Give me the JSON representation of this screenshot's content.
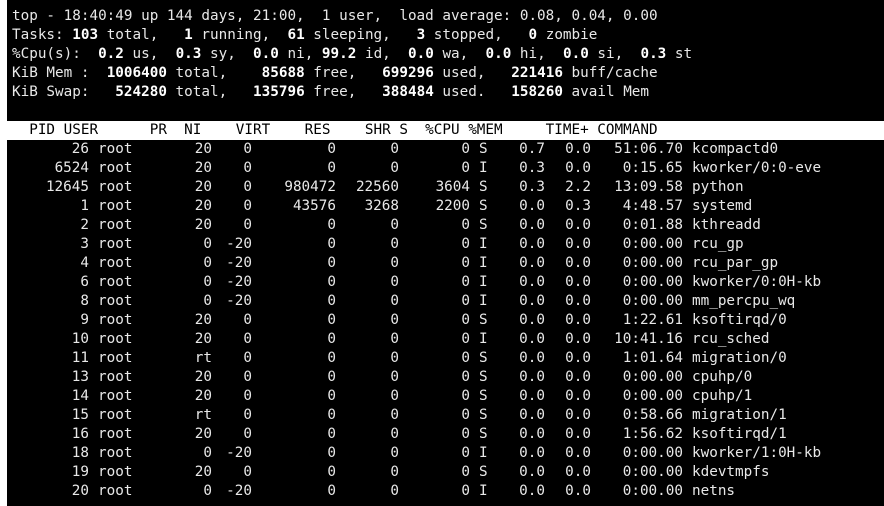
{
  "summary": {
    "l1": "top - 18:40:49 up 144 days, 21:00,  1 user,  load average: 0.08, 0.04, 0.00",
    "tasks": {
      "label": "Tasks:",
      "total": "103",
      "t_total": " total,   ",
      "running": "1",
      "t_running": " running,  ",
      "sleeping": "61",
      "t_sleeping": " sleeping,   ",
      "stopped": "3",
      "t_stopped": " stopped,   ",
      "zombie": "0",
      "t_zombie": " zombie"
    },
    "cpu": {
      "label": "%Cpu(s):  ",
      "us": "0.2",
      "t_us": " us,  ",
      "sy": "0.3",
      "t_sy": " sy,  ",
      "ni": "0.0",
      "t_ni": " ni, ",
      "id": "99.2",
      "t_id": " id,  ",
      "wa": "0.0",
      "t_wa": " wa,  ",
      "hi": "0.0",
      "t_hi": " hi,  ",
      "si": "0.0",
      "t_si": " si,  ",
      "st": "0.3",
      "t_st": " st"
    },
    "mem": {
      "label": "KiB Mem :  ",
      "total": "1006400",
      "t_total": " total,    ",
      "free": "85688",
      "t_free": " free,   ",
      "used": "699296",
      "t_used": " used,   ",
      "buff": "221416",
      "t_buff": " buff/cache"
    },
    "swap": {
      "label": "KiB Swap:   ",
      "total": "524280",
      "t_total": " total,   ",
      "free": "135796",
      "t_free": " free,   ",
      "used": "388484",
      "t_used": " used.   ",
      "avail": "158260",
      "t_avail": " avail Mem"
    }
  },
  "columns_header": "  PID USER      PR  NI    VIRT    RES    SHR S  %CPU %MEM     TIME+ COMMAND",
  "processes": [
    [
      "26",
      "root",
      "20",
      "0",
      "0",
      "0",
      "0",
      "S",
      "0.7",
      "0.0",
      "51:06.70",
      "kcompactd0"
    ],
    [
      "6524",
      "root",
      "20",
      "0",
      "0",
      "0",
      "0",
      "I",
      "0.3",
      "0.0",
      "0:15.65",
      "kworker/0:0-eve"
    ],
    [
      "12645",
      "root",
      "20",
      "0",
      "980472",
      "22560",
      "3604",
      "S",
      "0.3",
      "2.2",
      "13:09.58",
      "python"
    ],
    [
      "1",
      "root",
      "20",
      "0",
      "43576",
      "3268",
      "2200",
      "S",
      "0.0",
      "0.3",
      "4:48.57",
      "systemd"
    ],
    [
      "2",
      "root",
      "20",
      "0",
      "0",
      "0",
      "0",
      "S",
      "0.0",
      "0.0",
      "0:01.88",
      "kthreadd"
    ],
    [
      "3",
      "root",
      "0",
      "-20",
      "0",
      "0",
      "0",
      "I",
      "0.0",
      "0.0",
      "0:00.00",
      "rcu_gp"
    ],
    [
      "4",
      "root",
      "0",
      "-20",
      "0",
      "0",
      "0",
      "I",
      "0.0",
      "0.0",
      "0:00.00",
      "rcu_par_gp"
    ],
    [
      "6",
      "root",
      "0",
      "-20",
      "0",
      "0",
      "0",
      "I",
      "0.0",
      "0.0",
      "0:00.00",
      "kworker/0:0H-kb"
    ],
    [
      "8",
      "root",
      "0",
      "-20",
      "0",
      "0",
      "0",
      "I",
      "0.0",
      "0.0",
      "0:00.00",
      "mm_percpu_wq"
    ],
    [
      "9",
      "root",
      "20",
      "0",
      "0",
      "0",
      "0",
      "S",
      "0.0",
      "0.0",
      "1:22.61",
      "ksoftirqd/0"
    ],
    [
      "10",
      "root",
      "20",
      "0",
      "0",
      "0",
      "0",
      "I",
      "0.0",
      "0.0",
      "10:41.16",
      "rcu_sched"
    ],
    [
      "11",
      "root",
      "rt",
      "0",
      "0",
      "0",
      "0",
      "S",
      "0.0",
      "0.0",
      "1:01.64",
      "migration/0"
    ],
    [
      "13",
      "root",
      "20",
      "0",
      "0",
      "0",
      "0",
      "S",
      "0.0",
      "0.0",
      "0:00.00",
      "cpuhp/0"
    ],
    [
      "14",
      "root",
      "20",
      "0",
      "0",
      "0",
      "0",
      "S",
      "0.0",
      "0.0",
      "0:00.00",
      "cpuhp/1"
    ],
    [
      "15",
      "root",
      "rt",
      "0",
      "0",
      "0",
      "0",
      "S",
      "0.0",
      "0.0",
      "0:58.66",
      "migration/1"
    ],
    [
      "16",
      "root",
      "20",
      "0",
      "0",
      "0",
      "0",
      "S",
      "0.0",
      "0.0",
      "1:56.62",
      "ksoftirqd/1"
    ],
    [
      "18",
      "root",
      "0",
      "-20",
      "0",
      "0",
      "0",
      "I",
      "0.0",
      "0.0",
      "0:00.00",
      "kworker/1:0H-kb"
    ],
    [
      "19",
      "root",
      "20",
      "0",
      "0",
      "0",
      "0",
      "S",
      "0.0",
      "0.0",
      "0:00.00",
      "kdevtmpfs"
    ],
    [
      "20",
      "root",
      "0",
      "-20",
      "0",
      "0",
      "0",
      "I",
      "0.0",
      "0.0",
      "0:00.00",
      "netns"
    ]
  ]
}
